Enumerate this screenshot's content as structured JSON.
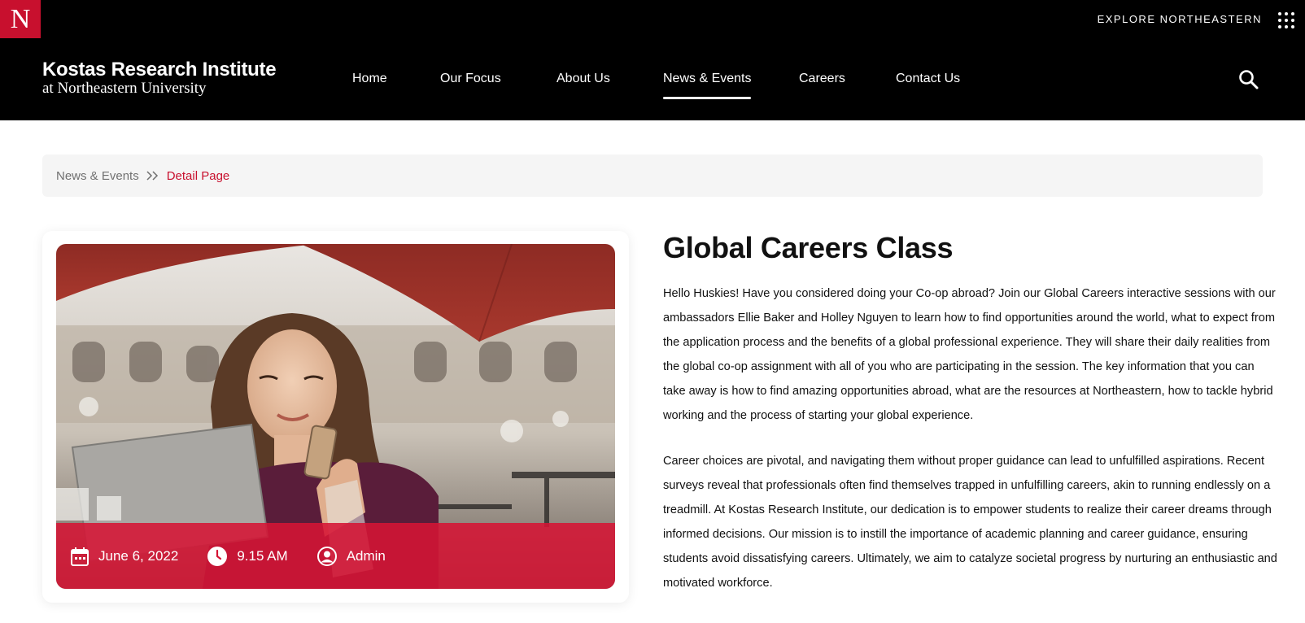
{
  "header": {
    "logo_letter": "N",
    "explore_label": "EXPLORE NORTHEASTERN",
    "brand_name": "Kostas Research Institute",
    "brand_sub": "at Northeastern University",
    "nav": [
      {
        "label": "Home"
      },
      {
        "label": "Our Focus"
      },
      {
        "label": "About Us"
      },
      {
        "label": "News & Events",
        "active": true
      },
      {
        "label": "Careers"
      },
      {
        "label": "Contact Us"
      }
    ],
    "search_icon": "search-icon",
    "menu_icon": "grid-menu-icon"
  },
  "breadcrumb": {
    "parent": "News & Events",
    "current": "Detail Page"
  },
  "event": {
    "date": "June 6, 2022",
    "time": "9.15 AM",
    "author": "Admin",
    "title": "Global Careers Class",
    "paragraphs": [
      "Hello Huskies! Have you considered doing your Co-op abroad? Join our Global Careers interactive sessions with our ambassadors Ellie Baker and Holley Nguyen to learn how to find opportunities around the world, what to expect from the application process and the benefits of a global professional experience. They will share their daily realities from the global co-op assignment with all of you who are participating in the session. The key information that you can take away is how to find amazing opportunities abroad, what are the resources at Northeastern, how to tackle hybrid working and the process of starting your global experience.",
      "Career choices are pivotal, and navigating them without proper guidance can lead to unfulfilled aspirations. Recent surveys reveal that professionals often find themselves trapped in unfulfilling careers, akin to running endlessly on a treadmill. At Kostas Research Institute, our dedication is to empower students to realize their career dreams through informed decisions. Our mission is to instill the importance of academic planning and career guidance, ensuring students avoid dissatisfying careers. Ultimately, we aim to catalyze societal progress by nurturing an enthusiastic and motivated workforce."
    ]
  },
  "colors": {
    "brand_red": "#c8102e",
    "header_bg": "#000000",
    "breadcrumb_bg": "#f5f5f5"
  }
}
